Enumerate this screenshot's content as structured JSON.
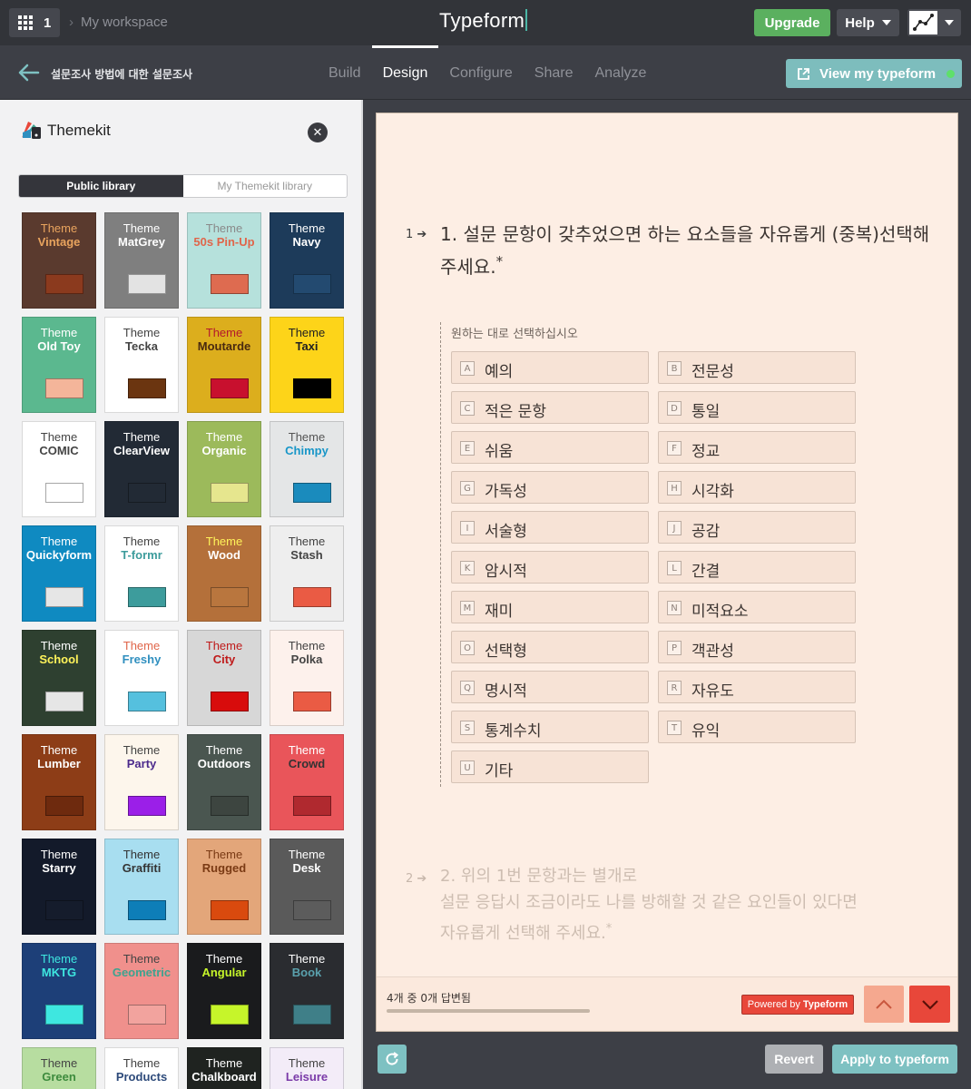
{
  "topbar": {
    "workspace_count": "1",
    "breadcrumb": "My workspace",
    "brand": "Typeform",
    "upgrade_label": "Upgrade",
    "help_label": "Help"
  },
  "subbar": {
    "form_title": "설문조사 방법에 대한 설문조사",
    "tabs": [
      {
        "label": "Build",
        "active": false
      },
      {
        "label": "Design",
        "active": true
      },
      {
        "label": "Configure",
        "active": false
      },
      {
        "label": "Share",
        "active": false
      },
      {
        "label": "Analyze",
        "active": false
      }
    ],
    "view_label": "View my typeform"
  },
  "sidebar": {
    "title": "Themekit",
    "tabs": [
      {
        "label": "Public library",
        "active": true
      },
      {
        "label": "My Themekit library",
        "active": false
      }
    ],
    "themes": [
      {
        "word": "Theme",
        "name": "Vintage",
        "bg": "#5a3a2e",
        "word_color": "#e9a45e",
        "name_color": "#e9a45e",
        "swatch": "#8b3a1e"
      },
      {
        "word": "Theme",
        "name": "MatGrey",
        "bg": "#7f7f7f",
        "word_color": "#ffffff",
        "name_color": "#ffffff",
        "swatch": "#e3e3e3"
      },
      {
        "word": "Theme",
        "name": "50s Pin-Up",
        "bg": "#b6e1dc",
        "word_color": "#8a8a8a",
        "name_color": "#e0654a",
        "swatch": "#de6b50"
      },
      {
        "word": "Theme",
        "name": "Navy",
        "bg": "#1d3b5a",
        "word_color": "#ffffff",
        "name_color": "#ffffff",
        "swatch": "#234a70"
      },
      {
        "word": "Theme",
        "name": "Old Toy",
        "bg": "#5bb88f",
        "word_color": "#ffffff",
        "name_color": "#ffffff",
        "swatch": "#f4b59a"
      },
      {
        "word": "Theme",
        "name": "Tecka",
        "bg": "#ffffff",
        "word_color": "#444444",
        "name_color": "#444444",
        "swatch": "#6b3510"
      },
      {
        "word": "Theme",
        "name": "Moutarde",
        "bg": "#dcae1d",
        "word_color": "#b3192c",
        "name_color": "#4a2a10",
        "swatch": "#c8102e"
      },
      {
        "word": "Theme",
        "name": "Taxi",
        "bg": "#fdd419",
        "word_color": "#222222",
        "name_color": "#222222",
        "swatch": "#000000"
      },
      {
        "word": "Theme",
        "name": "COMIC",
        "bg": "#ffffff",
        "word_color": "#444444",
        "name_color": "#444444",
        "swatch": "#ffffff"
      },
      {
        "word": "Theme",
        "name": "ClearView",
        "bg": "#222a35",
        "word_color": "#ffffff",
        "name_color": "#ffffff",
        "swatch": "#222a35"
      },
      {
        "word": "Theme",
        "name": "Organic",
        "bg": "#9cba5b",
        "word_color": "#ffffff",
        "name_color": "#ffffff",
        "swatch": "#e6e68e"
      },
      {
        "word": "Theme",
        "name": "Chimpy",
        "bg": "#e4e6e7",
        "word_color": "#555555",
        "name_color": "#1896c8",
        "swatch": "#1a8bbd"
      },
      {
        "word": "Theme",
        "name": "Quickyform",
        "bg": "#0f8ac1",
        "word_color": "#ffffff",
        "name_color": "#ffffff",
        "swatch": "#e6e6e6"
      },
      {
        "word": "Theme",
        "name": "T-formr",
        "bg": "#ffffff",
        "word_color": "#444444",
        "name_color": "#3d9c9c",
        "swatch": "#3d9c9c"
      },
      {
        "word": "Theme",
        "name": "Wood",
        "bg": "#b4703a",
        "word_color": "#fff35a",
        "name_color": "#ffffff",
        "swatch": "#b9763e"
      },
      {
        "word": "Theme",
        "name": "Stash",
        "bg": "#eeeeee",
        "word_color": "#444444",
        "name_color": "#444444",
        "swatch": "#ea5b44"
      },
      {
        "word": "Theme",
        "name": "School",
        "bg": "#2e4030",
        "word_color": "#ffffff",
        "name_color": "#fff35a",
        "swatch": "#e6e6e6"
      },
      {
        "word": "Theme",
        "name": "Freshy",
        "bg": "#ffffff",
        "word_color": "#e0654a",
        "name_color": "#2f8fbf",
        "swatch": "#55c0de"
      },
      {
        "word": "Theme",
        "name": "City",
        "bg": "#d7d7d7",
        "word_color": "#bf1a1a",
        "name_color": "#bf1a1a",
        "swatch": "#d80c0c"
      },
      {
        "word": "Theme",
        "name": "Polka",
        "bg": "#fdf1ec",
        "word_color": "#444444",
        "name_color": "#444444",
        "swatch": "#ea5b44"
      },
      {
        "word": "Theme",
        "name": "Lumber",
        "bg": "#8d3d17",
        "word_color": "#ffffff",
        "name_color": "#ffffff",
        "swatch": "#6e2a0e"
      },
      {
        "word": "Theme",
        "name": "Party",
        "bg": "#fdf6ec",
        "word_color": "#444444",
        "name_color": "#4b2a8c",
        "swatch": "#9b1fe8"
      },
      {
        "word": "Theme",
        "name": "Outdoors",
        "bg": "#4a5650",
        "word_color": "#ffffff",
        "name_color": "#ffffff",
        "swatch": "#3d4540"
      },
      {
        "word": "Theme",
        "name": "Crowd",
        "bg": "#e9555a",
        "word_color": "#ffffff",
        "name_color": "#333333",
        "swatch": "#b0292f"
      },
      {
        "word": "Theme",
        "name": "Starry",
        "bg": "#131a2a",
        "word_color": "#ffffff",
        "name_color": "#ffffff",
        "swatch": "#151c2c"
      },
      {
        "word": "Theme",
        "name": "Graffiti",
        "bg": "#a8def0",
        "word_color": "#333333",
        "name_color": "#333333",
        "swatch": "#0e7eb8"
      },
      {
        "word": "Theme",
        "name": "Rugged",
        "bg": "#e3a67a",
        "word_color": "#7a3a14",
        "name_color": "#7a3a14",
        "swatch": "#d94a0e"
      },
      {
        "word": "Theme",
        "name": "Desk",
        "bg": "#5a5a5a",
        "word_color": "#ffffff",
        "name_color": "#ffffff",
        "swatch": "#5c5c5c"
      },
      {
        "word": "Theme",
        "name": "MKTG",
        "bg": "#1d3f78",
        "word_color": "#3ee7e0",
        "name_color": "#3ee7e0",
        "swatch": "#3ee7e0"
      },
      {
        "word": "Theme",
        "name": "Geometric",
        "bg": "#f0908c",
        "word_color": "#444444",
        "name_color": "#3ea38f",
        "swatch": "#f2a39e"
      },
      {
        "word": "Theme",
        "name": "Angular",
        "bg": "#1a1b1d",
        "word_color": "#ffffff",
        "name_color": "#c6f52a",
        "swatch": "#c6f52a"
      },
      {
        "word": "Theme",
        "name": "Book",
        "bg": "#2a2c30",
        "word_color": "#ffffff",
        "name_color": "#5aa1ad",
        "swatch": "#3f7f88"
      },
      {
        "word": "Theme",
        "name": "Green",
        "bg": "#b7dda0",
        "word_color": "#444444",
        "name_color": "#3d8b3d",
        "swatch": "#3d8b3d"
      },
      {
        "word": "Theme",
        "name": "Products",
        "bg": "#ffffff",
        "word_color": "#444444",
        "name_color": "#2d4a7a",
        "swatch": "#2d4a7a"
      },
      {
        "word": "Theme",
        "name": "Chalkboard",
        "bg": "#1f2320",
        "word_color": "#ffffff",
        "name_color": "#ffffff",
        "swatch": "#1f2320"
      },
      {
        "word": "Theme",
        "name": "Leisure",
        "bg": "#f3ecf8",
        "word_color": "#444444",
        "name_color": "#7a3aa8",
        "swatch": "#7a3aa8"
      }
    ]
  },
  "preview": {
    "q1_number": "1",
    "q1_text": "1. 설문 문항이 갖추었으면 하는 요소들을 자유롭게 (중복)선택해 주세요.",
    "hint": "원하는 대로 선택하십시오",
    "choices": [
      {
        "key": "A",
        "label": "예의"
      },
      {
        "key": "B",
        "label": "전문성"
      },
      {
        "key": "C",
        "label": "적은 문항"
      },
      {
        "key": "D",
        "label": "통일"
      },
      {
        "key": "E",
        "label": "쉬움"
      },
      {
        "key": "F",
        "label": "정교"
      },
      {
        "key": "G",
        "label": "가독성"
      },
      {
        "key": "H",
        "label": "시각화"
      },
      {
        "key": "I",
        "label": "서술형"
      },
      {
        "key": "J",
        "label": "공감"
      },
      {
        "key": "K",
        "label": "암시적"
      },
      {
        "key": "L",
        "label": "간결"
      },
      {
        "key": "M",
        "label": "재미"
      },
      {
        "key": "N",
        "label": "미적요소"
      },
      {
        "key": "O",
        "label": "선택형"
      },
      {
        "key": "P",
        "label": "객관성"
      },
      {
        "key": "Q",
        "label": "명시적"
      },
      {
        "key": "R",
        "label": "자유도"
      },
      {
        "key": "S",
        "label": "통계수치"
      },
      {
        "key": "T",
        "label": "유익"
      },
      {
        "key": "U",
        "label": "기타"
      }
    ],
    "q2_number": "2",
    "q2_line1": "2. 위의 1번 문항과는 별개로",
    "q2_line2": "설문 응답시 조금이라도 나를 방해할 것 같은 요인들이 있다면",
    "q2_line3": "자유롭게 선택해 주세요.",
    "answered": "4개 중 0개 답변됨",
    "progress": 0,
    "powered_prefix": "Powered by",
    "powered_brand": "Typeform"
  },
  "actions": {
    "revert_label": "Revert",
    "apply_label": "Apply to typeform"
  },
  "colors": {
    "accent": "#7ec1c2",
    "upgrade": "#5bb05f",
    "nav_button": "#e8473a",
    "preview_bg": "#fdeee4"
  }
}
